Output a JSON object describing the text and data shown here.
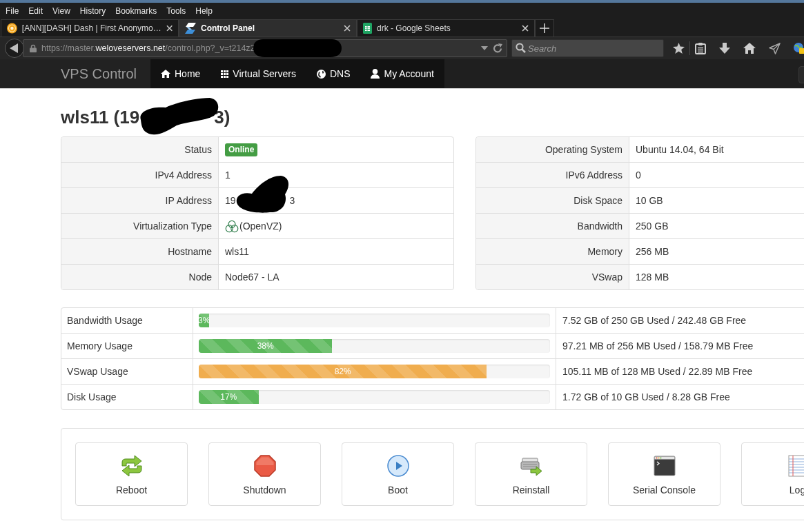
{
  "browser": {
    "menu": [
      "File",
      "Edit",
      "View",
      "History",
      "Bookmarks",
      "Tools",
      "Help"
    ],
    "tabs": [
      {
        "title": "[ANN][DASH] Dash | First Anonymo…",
        "kind": "forum",
        "selected": false
      },
      {
        "title": "Control Panel",
        "kind": "panel",
        "selected": true
      },
      {
        "title": "drk - Google Sheets",
        "kind": "spreadsheet",
        "selected": false
      }
    ],
    "address": "https://master.**weloveservers.net**/control.php?_v=t214z2",
    "search": {
      "placeholder": "Search"
    }
  },
  "navbar": {
    "brand": "VPS Control",
    "items": [
      {
        "label": "Home",
        "kind": "home"
      },
      {
        "label": "Virtual Servers",
        "kind": "servers"
      },
      {
        "label": "DNS",
        "kind": "dns"
      },
      {
        "label": "My Account",
        "kind": "account"
      }
    ]
  },
  "server": {
    "title_start": "wls11 (19",
    "title_end": "3)"
  },
  "details_left": [
    {
      "label": "Status",
      "value": "Online",
      "kind": "badge"
    },
    {
      "label": "IPv4 Address",
      "value": "1",
      "kind": "text"
    },
    {
      "label": "IP Address",
      "value_start": "19",
      "value_end": "3",
      "kind": "redacted"
    },
    {
      "label": "Virtualization Type",
      "value": "(OpenVZ)",
      "kind": "icon"
    },
    {
      "label": "Hostname",
      "value": "wls11",
      "kind": "text"
    },
    {
      "label": "Node",
      "value": "Node67 - LA",
      "kind": "text"
    }
  ],
  "details_right": [
    {
      "label": "Operating System",
      "value": "Ubuntu 14.04, 64 Bit",
      "kind": "text"
    },
    {
      "label": "IPv6 Address",
      "value": "0",
      "kind": "text"
    },
    {
      "label": "Disk Space",
      "value": "10 GB",
      "kind": "text"
    },
    {
      "label": "Bandwidth",
      "value": "250 GB",
      "kind": "text"
    },
    {
      "label": "Memory",
      "value": "256 MB",
      "kind": "text"
    },
    {
      "label": "VSwap",
      "value": "128 MB",
      "kind": "text"
    }
  ],
  "usage": [
    {
      "label": "Bandwidth Usage",
      "level": 0.03,
      "percent": "3%",
      "kind": "success",
      "summary": "7.52 GB of 250 GB Used / 242.48 GB Free"
    },
    {
      "label": "Memory Usage",
      "level": 0.38,
      "percent": "38%",
      "kind": "success",
      "summary": "97.21 MB of 256 MB Used / 158.79 MB Free"
    },
    {
      "label": "VSwap Usage",
      "level": 0.82,
      "percent": "82%",
      "kind": "warning",
      "summary": "105.11 MB of 128 MB Used / 22.89 MB Free"
    },
    {
      "label": "Disk Usage",
      "level": 0.17,
      "percent": "17%",
      "kind": "success",
      "summary": "1.72 GB of 10 GB Used / 8.28 GB Free"
    }
  ],
  "actions": [
    {
      "label": "Reboot",
      "kind": "reboot"
    },
    {
      "label": "Shutdown",
      "kind": "shutdown"
    },
    {
      "label": "Boot",
      "kind": "boot"
    },
    {
      "label": "Reinstall",
      "kind": "reinstall"
    },
    {
      "label": "Serial Console",
      "kind": "console"
    },
    {
      "label": "Log",
      "kind": "log"
    }
  ]
}
